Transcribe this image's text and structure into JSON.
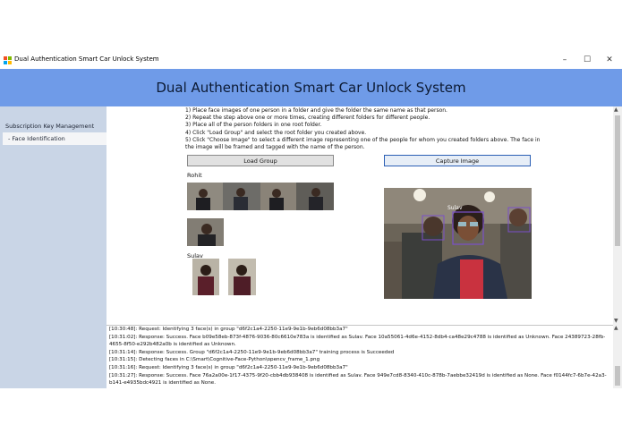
{
  "window": {
    "title": "Dual Authentication Smart Car Unlock System",
    "controls": [
      "–",
      "☐",
      "✕"
    ],
    "logo_colors": [
      "#f25022",
      "#7fba00",
      "#00a4ef",
      "#ffb900"
    ]
  },
  "header": {
    "title": "Dual Authentication Smart Car Unlock System",
    "color": "#6f9be8"
  },
  "sidebar": {
    "items": [
      {
        "label": "Subscription Key Management",
        "selected": false
      },
      {
        "label": "- Face Identification",
        "selected": true
      }
    ]
  },
  "instructions": [
    "1) Place face images of one person in a folder and give the folder the same name as that person.",
    "2) Repeat the step above one or more times, creating different folders for different people.",
    "3) Place all of the person folders in one root folder.",
    "4) Click \"Load Group\" and select the root folder you created above.",
    "5) Click \"Choose Image\" to select a different image representing one of the people for whom you created folders above. The face in",
    "the image will be framed and tagged with the name of the person."
  ],
  "buttons": {
    "load_group": "Load Group",
    "capture_image": "Capture Image"
  },
  "persons": [
    {
      "name": "Rohit",
      "image_count": 5
    },
    {
      "name": "Sulav",
      "image_count": 2
    }
  ],
  "capture": {
    "face_tag": "Sulav",
    "box_color": "#7b4fc9"
  },
  "log": [
    "[10:30:48]: Request: Identifying 3 face(s) in group \"d6f2c1a4-2250-11e9-9e1b-9eb6d08bb3a7\"",
    "[10:31:02]: Response: Success. Face b09e58eb-873f-4876-9036-80c6610e783a is identified as Sulav. Face 10a55061-4d6e-4152-8db4-ca48e29c4788 is identified as Unknown. Face 24389723-28fb-",
    "4655-8f50-e292b482a0b is identified as Unknown.",
    "[10:31:14]: Response: Success. Group \"d6f2c1a4-2250-11e9-9e1b-9eb6d08bb3a7\" training process is Succeeded",
    "[10:31:15]: Detecting faces in C:\\Smart\\Cognitive-Face-Python\\opencv_frame_1.png",
    "[10:31:16]: Request: Identifying 3 face(s) in group \"d6f2c1a4-2250-11e9-9e1b-9eb6d08bb3a7\"",
    "[10:31:27]: Response: Success. Face 76a2a00e-1f17-4375-9f20-cbb4db938408 is identified as Sulav. Face 949e7cd8-8340-410c-878b-7aebbe32419d is identified as None. Face f0144fc7-6b7e-42a3-",
    "b141-e4935bdc4921 is identified as None."
  ]
}
